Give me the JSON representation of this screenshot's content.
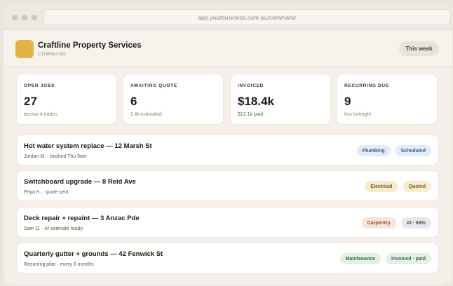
{
  "browser": {
    "url": "app.yourbusiness.com.au/command"
  },
  "header": {
    "company": "Craftline Property Services",
    "subtitle": "COMMAND",
    "period_button": "This week",
    "brand_color": "#e2b445"
  },
  "stats": [
    {
      "label": "OPEN JOBS",
      "value": "27",
      "note": "across 4 trades"
    },
    {
      "label": "AWAITING QUOTE",
      "value": "6",
      "note": "2 AI-estimated"
    },
    {
      "label": "INVOICED",
      "value": "$18.4k",
      "note": "$12.1k paid"
    },
    {
      "label": "RECURRING DUE",
      "value": "9",
      "note": "this fortnight"
    }
  ],
  "jobs": [
    {
      "title": "Hot water system replace — 12 Marsh St",
      "meta": "Jordan M. · booked Thu 9am",
      "tags": [
        "Plumbing",
        "Scheduled"
      ]
    },
    {
      "title": "Switchboard upgrade — 8 Reid Ave",
      "meta": "Priya K. · quote sent",
      "tags": [
        "Electrical",
        "Quoted"
      ]
    },
    {
      "title": "Deck repair + repaint — 3 Anzac Pde",
      "meta": "Sam O. · AI estimate ready",
      "tags": [
        "Carpentry",
        "AI · 84%"
      ]
    },
    {
      "title": "Quarterly gutter + grounds — 42 Fenwick St",
      "meta": "Recurring plan · every 3 months",
      "tags": [
        "Maintenance",
        "Invoiced · paid"
      ]
    }
  ]
}
